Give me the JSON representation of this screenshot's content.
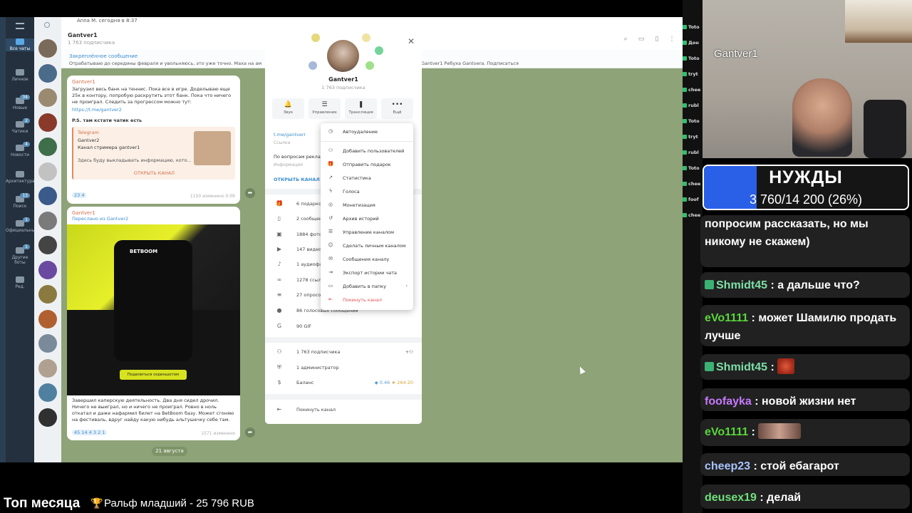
{
  "colors": {
    "tg_accent": "#3a8ed0",
    "danger": "#e05252",
    "goal_fill": "#2a5fe8",
    "chat_bg": "#8ea377"
  },
  "telegram": {
    "window_strip": "Anna M. сегодня в 8:37",
    "folders": [
      {
        "label": "Все чаты",
        "badge": "",
        "icon": "chat-bubble-icon"
      },
      {
        "label": "Личное",
        "badge": "",
        "icon": "folder-icon"
      },
      {
        "label": "Новые",
        "badge": "34",
        "icon": "folder-icon"
      },
      {
        "label": "Чатики",
        "badge": "2",
        "icon": "folder-icon"
      },
      {
        "label": "Новости",
        "badge": "4",
        "icon": "folder-icon"
      },
      {
        "label": "Архитектура",
        "badge": "",
        "icon": "folder-icon"
      },
      {
        "label": "Поиск",
        "badge": "13",
        "icon": "folder-icon"
      },
      {
        "label": "Официальные",
        "badge": "1",
        "icon": "folder-icon"
      },
      {
        "label": "Другие боты",
        "badge": "1",
        "icon": "folder-icon"
      },
      {
        "label": "Ред.",
        "badge": "",
        "icon": "edit-icon"
      }
    ],
    "chat": {
      "title": "Gantver1",
      "subtitle": "1 763 подписчика",
      "pinned_title": "Закреплённое сообщение",
      "pinned_text": "Отрабатываю до середины февраля и увольняюсь, это уже точно. Маха на ам",
      "pinned_tail": "Gantver1  Ребуха Gantvera. Подписаться",
      "msg1": {
        "author": "Gantver1",
        "text": "Загрузил весь банк на теннис. Пока все в игре. Доделываю еще 25к в контору, попробую раскрутить этот банк. Пока что ничего не проиграл. Следить за прогрессом можно тут:",
        "link": "https://t.me/gantver2",
        "ps": "P.S. там кстати чатик есть",
        "card_src": "Telegram",
        "card_name": "Gantver2",
        "card_desc": "Канал стримера gantver1",
        "card_info": "Здесь буду выкладывать информацию, кото...",
        "card_button": "ОТКРЫТЬ КАНАЛ",
        "reactions": "23  4",
        "views": "1150  изменено 0:09"
      },
      "msg2": {
        "author": "Gantver1",
        "forwarded_from": "Переслано из",
        "forwarded_name": "Gantver2",
        "phone_logo": "BETBOOM",
        "phone_button": "Поделиться скриншотом",
        "text": "Завершил каперскую деятельность. Два дня сидел дрочил. Ничего не выиграл, но и ничего не проиграл. Ровно в ноль откатал и даже нафармил билет на BetBoom базу. Может сгоняю на фестиваль, вдруг найду какую нибудь альтушечку себе там.",
        "reactions": "45  14  4  3  2  1",
        "views": "1571  изменено"
      },
      "date_pill": "21 августа"
    },
    "modal": {
      "name": "Gantver1",
      "subscribers": "1 763 подписчика",
      "actions": [
        {
          "icon": "bell-icon",
          "glyph": "🔔",
          "label": "Звук"
        },
        {
          "icon": "sliders-icon",
          "glyph": "☰",
          "label": "Управление"
        },
        {
          "icon": "broadcast-icon",
          "glyph": "❚",
          "label": "Трансляция"
        },
        {
          "icon": "more-icon",
          "glyph": "•••",
          "label": "Ещё"
        }
      ],
      "link": "t.me/gantverr",
      "link_caption": "Ссылка",
      "about": "По вопросам рекла",
      "about_caption": "Информация",
      "open_channel": "ОТКРЫТЬ КАНАЛ",
      "media": [
        {
          "icon": "gift-icon",
          "glyph": "🎁",
          "label": "6 подарков"
        },
        {
          "icon": "bookmark-icon",
          "glyph": "▯",
          "label": "2 сообщения"
        },
        {
          "icon": "photo-icon",
          "glyph": "▣",
          "label": "1884 фото"
        },
        {
          "icon": "video-icon",
          "glyph": "▶",
          "label": "147 видео"
        },
        {
          "icon": "audio-icon",
          "glyph": "♪",
          "label": "1 аудиофайл"
        },
        {
          "icon": "link-icon",
          "glyph": "∞",
          "label": "1278 ссылок"
        },
        {
          "icon": "poll-icon",
          "glyph": "≡",
          "label": "27 опросов"
        },
        {
          "icon": "mic-icon",
          "glyph": "●",
          "label": "86 голосовых сообщений"
        },
        {
          "icon": "gif-icon",
          "glyph": "G",
          "label": "90 GIF"
        }
      ],
      "members": "1 763 подписчика",
      "admins": "1 администратор",
      "balance_label": "Баланс",
      "balance_ton": "0.46",
      "balance_stars": "264.20",
      "leave": "Покинуть канал"
    },
    "context_menu": [
      {
        "icon": "timer-icon",
        "glyph": "◷",
        "label": "Автоудаление",
        "danger": false
      },
      {
        "icon": "add-user-icon",
        "glyph": "⚇",
        "label": "Добавить пользователей",
        "danger": false
      },
      {
        "icon": "gift-icon",
        "glyph": "🎁",
        "label": "Отправить подарок",
        "danger": false
      },
      {
        "icon": "stats-icon",
        "glyph": "↗",
        "label": "Статистика",
        "danger": false
      },
      {
        "icon": "boost-icon",
        "glyph": "ϟ",
        "label": "Голоса",
        "danger": false
      },
      {
        "icon": "coin-icon",
        "glyph": "◎",
        "label": "Монетизация",
        "danger": false
      },
      {
        "icon": "history-icon",
        "glyph": "↺",
        "label": "Архив историй",
        "danger": false
      },
      {
        "icon": "sliders-icon",
        "glyph": "☰",
        "label": "Управление каналом",
        "danger": false
      },
      {
        "icon": "person-icon",
        "glyph": "☺",
        "label": "Сделать личным каналом",
        "danger": false
      },
      {
        "icon": "message-icon",
        "glyph": "✉",
        "label": "Сообщения каналу",
        "danger": false
      },
      {
        "icon": "export-icon",
        "glyph": "⇥",
        "label": "Экспорт истории чата",
        "danger": false
      },
      {
        "icon": "folder-add-icon",
        "glyph": "▭",
        "label": "Добавить в папку",
        "danger": false
      },
      {
        "icon": "leave-icon",
        "glyph": "⇤",
        "label": "Покинуть канал",
        "danger": true
      }
    ]
  },
  "stream": {
    "cam_name": "Gantver1",
    "goal": {
      "title": "НУЖДЫ",
      "value_text": "3 760/14 200 (26%)",
      "progress": 0.26
    },
    "left_strip": [
      "Toto",
      "Дон",
      "Toto",
      "tryt",
      "chee",
      "rubl",
      "Toto",
      "tryt",
      "rubl",
      "Toto",
      "chee",
      "foof",
      "chee"
    ],
    "chat": [
      {
        "user": "",
        "user_color": "#ffffff",
        "text": "попросим рассказать, но мы никому не скажем)"
      },
      {
        "user": "Shmidt45",
        "user_color": "#7ee0a8",
        "text": "а дальше что?",
        "badge": true
      },
      {
        "user": "eVo1111",
        "user_color": "#59d63b",
        "text": "может Шамилю продать лучше"
      },
      {
        "user": "Shmidt45",
        "user_color": "#7ee0a8",
        "text": "",
        "badge": true,
        "emote": "red-face-emote"
      },
      {
        "user": "foofayka",
        "user_color": "#c779ff",
        "text": "новой жизни нет"
      },
      {
        "user": "eVo1111",
        "user_color": "#59d63b",
        "text": "",
        "emote": "face-emote"
      },
      {
        "user": "cheep23",
        "user_color": "#a9c4ff",
        "text": "стой ебагарот"
      },
      {
        "user": "deusex19",
        "user_color": "#6fe07a",
        "text": "делай"
      }
    ],
    "top_title": "Топ месяца",
    "top_donor": "Ральф младший - 25 796 RUB"
  }
}
